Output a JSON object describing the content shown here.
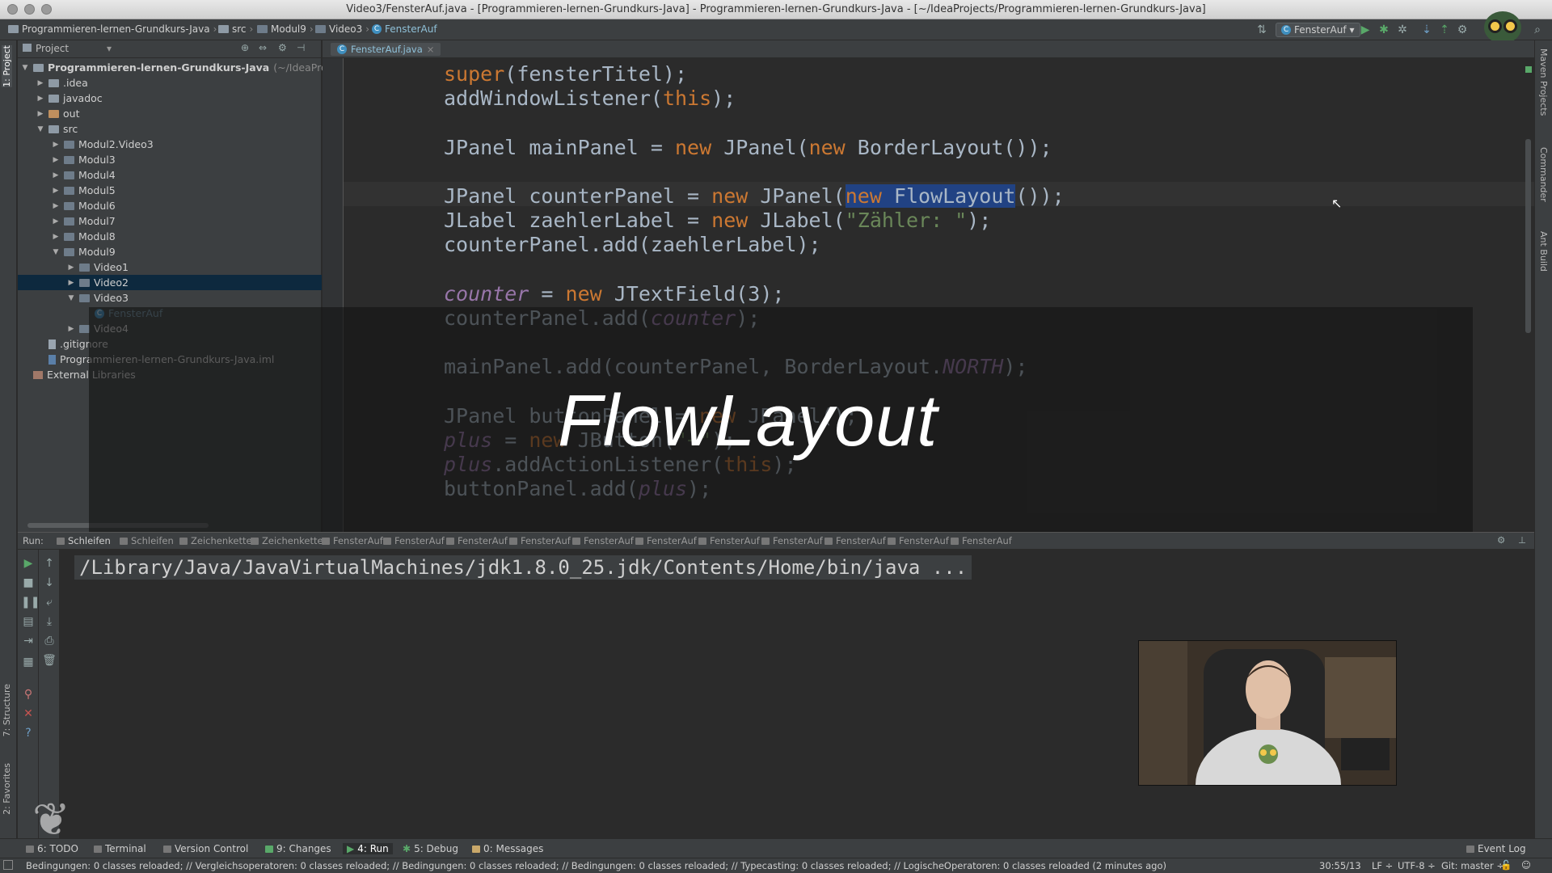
{
  "window": {
    "title": "Video3/FensterAuf.java - [Programmieren-lernen-Grundkurs-Java] - Programmieren-lernen-Grundkurs-Java - [~/IdeaProjects/Programmieren-lernen-Grundkurs-Java]"
  },
  "navbar": {
    "crumbs": [
      "Programmieren-lernen-Grundkurs-Java",
      "src",
      "Modul9",
      "Video3",
      "FensterAuf"
    ],
    "run_config": "FensterAuf"
  },
  "sidebar_tabs": {
    "project": "1: Project",
    "structure": "7: Structure",
    "favorites": "2: Favorites",
    "maven": "Maven Projects",
    "commander": "Commander",
    "ant": "Ant Build"
  },
  "project_panel": {
    "header": "Project",
    "tree": [
      {
        "label": "Programmieren-lernen-Grundkurs-Java",
        "suffix": "(~/IdeaProjects/P",
        "depth": 0,
        "arrow": "▼",
        "icon": "folder"
      },
      {
        "label": ".idea",
        "depth": 1,
        "arrow": "▶",
        "icon": "folder"
      },
      {
        "label": "javadoc",
        "depth": 1,
        "arrow": "▶",
        "icon": "folder"
      },
      {
        "label": "out",
        "depth": 1,
        "arrow": "▶",
        "icon": "folder-out"
      },
      {
        "label": "src",
        "depth": 1,
        "arrow": "▼",
        "icon": "folder"
      },
      {
        "label": "Modul2.Video3",
        "depth": 2,
        "arrow": "▶",
        "icon": "package"
      },
      {
        "label": "Modul3",
        "depth": 2,
        "arrow": "▶",
        "icon": "package"
      },
      {
        "label": "Modul4",
        "depth": 2,
        "arrow": "▶",
        "icon": "package"
      },
      {
        "label": "Modul5",
        "depth": 2,
        "arrow": "▶",
        "icon": "package"
      },
      {
        "label": "Modul6",
        "depth": 2,
        "arrow": "▶",
        "icon": "package"
      },
      {
        "label": "Modul7",
        "depth": 2,
        "arrow": "▶",
        "icon": "package"
      },
      {
        "label": "Modul8",
        "depth": 2,
        "arrow": "▶",
        "icon": "package"
      },
      {
        "label": "Modul9",
        "depth": 2,
        "arrow": "▼",
        "icon": "package"
      },
      {
        "label": "Video1",
        "depth": 3,
        "arrow": "▶",
        "icon": "package"
      },
      {
        "label": "Video2",
        "depth": 3,
        "arrow": "▶",
        "icon": "package",
        "selected": true
      },
      {
        "label": "Video3",
        "depth": 3,
        "arrow": "▼",
        "icon": "package"
      },
      {
        "label": "FensterAuf",
        "depth": 4,
        "arrow": "",
        "icon": "class"
      },
      {
        "label": "Video4",
        "depth": 3,
        "arrow": "▶",
        "icon": "package"
      },
      {
        "label": ".gitignore",
        "depth": 1,
        "arrow": "",
        "icon": "file"
      },
      {
        "label": "Programmieren-lernen-Grundkurs-Java.iml",
        "depth": 1,
        "arrow": "",
        "icon": "iml"
      },
      {
        "label": "External Libraries",
        "depth": 0,
        "arrow": "",
        "icon": "library"
      }
    ]
  },
  "editor": {
    "tab_label": "FensterAuf.java",
    "lines": [
      [
        {
          "t": "super",
          "c": "kw"
        },
        {
          "t": "(fensterTitel);",
          "c": ""
        }
      ],
      [
        {
          "t": "addWindowListener(",
          "c": ""
        },
        {
          "t": "this",
          "c": "kw"
        },
        {
          "t": ");",
          "c": ""
        }
      ],
      [],
      [
        {
          "t": "JPanel mainPanel = ",
          "c": ""
        },
        {
          "t": "new",
          "c": "kw"
        },
        {
          "t": " JPanel(",
          "c": ""
        },
        {
          "t": "new",
          "c": "kw"
        },
        {
          "t": " BorderLayout());",
          "c": ""
        }
      ],
      [],
      [
        {
          "t": "JPanel counterPanel = ",
          "c": ""
        },
        {
          "t": "new",
          "c": "kw"
        },
        {
          "t": " JPanel(",
          "c": ""
        },
        {
          "t": "new",
          "c": "kw sel"
        },
        {
          "t": " FlowLayout",
          "c": "sel"
        },
        {
          "t": "());",
          "c": ""
        }
      ],
      [
        {
          "t": "JLabel zaehlerLabel = ",
          "c": ""
        },
        {
          "t": "new",
          "c": "kw"
        },
        {
          "t": " JLabel(",
          "c": ""
        },
        {
          "t": "\"Zähler: \"",
          "c": "str"
        },
        {
          "t": ");",
          "c": ""
        }
      ],
      [
        {
          "t": "counterPanel.add(zaehlerLabel);",
          "c": ""
        }
      ],
      [],
      [
        {
          "t": "counter",
          "c": "ital"
        },
        {
          "t": " = ",
          "c": ""
        },
        {
          "t": "new",
          "c": "kw"
        },
        {
          "t": " JTextField(3);",
          "c": ""
        }
      ],
      [
        {
          "t": "counterPanel.add(",
          "c": ""
        },
        {
          "t": "counter",
          "c": "ital"
        },
        {
          "t": ");",
          "c": ""
        }
      ],
      [],
      [
        {
          "t": "mainPanel.add(counterPanel, BorderLayout.",
          "c": ""
        },
        {
          "t": "NORTH",
          "c": "ital"
        },
        {
          "t": ");",
          "c": ""
        }
      ],
      [],
      [
        {
          "t": "JPanel buttonPanel = ",
          "c": ""
        },
        {
          "t": "new",
          "c": "kw"
        },
        {
          "t": " JPanel();",
          "c": ""
        }
      ],
      [
        {
          "t": "plus",
          "c": "ital"
        },
        {
          "t": " = ",
          "c": ""
        },
        {
          "t": "new",
          "c": "kw"
        },
        {
          "t": " JButton(",
          "c": ""
        },
        {
          "t": "\"+\"",
          "c": "str"
        },
        {
          "t": ");",
          "c": ""
        }
      ],
      [
        {
          "t": "plus",
          "c": "ital"
        },
        {
          "t": ".addActionListener(",
          "c": ""
        },
        {
          "t": "this",
          "c": "kw"
        },
        {
          "t": ");",
          "c": ""
        }
      ],
      [
        {
          "t": "buttonPanel.add(",
          "c": ""
        },
        {
          "t": "plus",
          "c": "ital"
        },
        {
          "t": ");",
          "c": ""
        }
      ]
    ]
  },
  "overlay": {
    "title": "FlowLayout"
  },
  "run_panel": {
    "label": "Run:",
    "tabs": [
      "Schleifen",
      "Schleifen",
      "Zeichenketten",
      "Zeichenketten",
      "FensterAuf",
      "FensterAuf",
      "FensterAuf",
      "FensterAuf",
      "FensterAuf",
      "FensterAuf",
      "FensterAuf",
      "FensterAuf",
      "FensterAuf",
      "FensterAuf",
      "FensterAuf"
    ],
    "console_line": "/Library/Java/JavaVirtualMachines/jdk1.8.0_25.jdk/Contents/Home/bin/java ..."
  },
  "bottom_tabs": {
    "todo": "6: TODO",
    "terminal": "Terminal",
    "vcs": "Version Control",
    "changes": "9: Changes",
    "run": "4: Run",
    "debug": "5: Debug",
    "messages": "0: Messages",
    "event_log": "Event Log"
  },
  "status": {
    "message": "Bedingungen: 0 classes reloaded; // Vergleichsoperatoren: 0 classes reloaded; // Bedingungen: 0 classes reloaded; // Bedingungen: 0 classes reloaded; // Typecasting: 0 classes reloaded; // LogischeOperatoren: 0 classes reloaded (2 minutes ago)",
    "position": "30:55/13",
    "line_sep": "LF ÷",
    "encoding": "UTF-8 ÷",
    "git": "Git: master ÷"
  },
  "colors": {
    "keyword": "#cc7832",
    "string": "#6a8759",
    "field": "#9876aa",
    "selection": "#214283"
  }
}
